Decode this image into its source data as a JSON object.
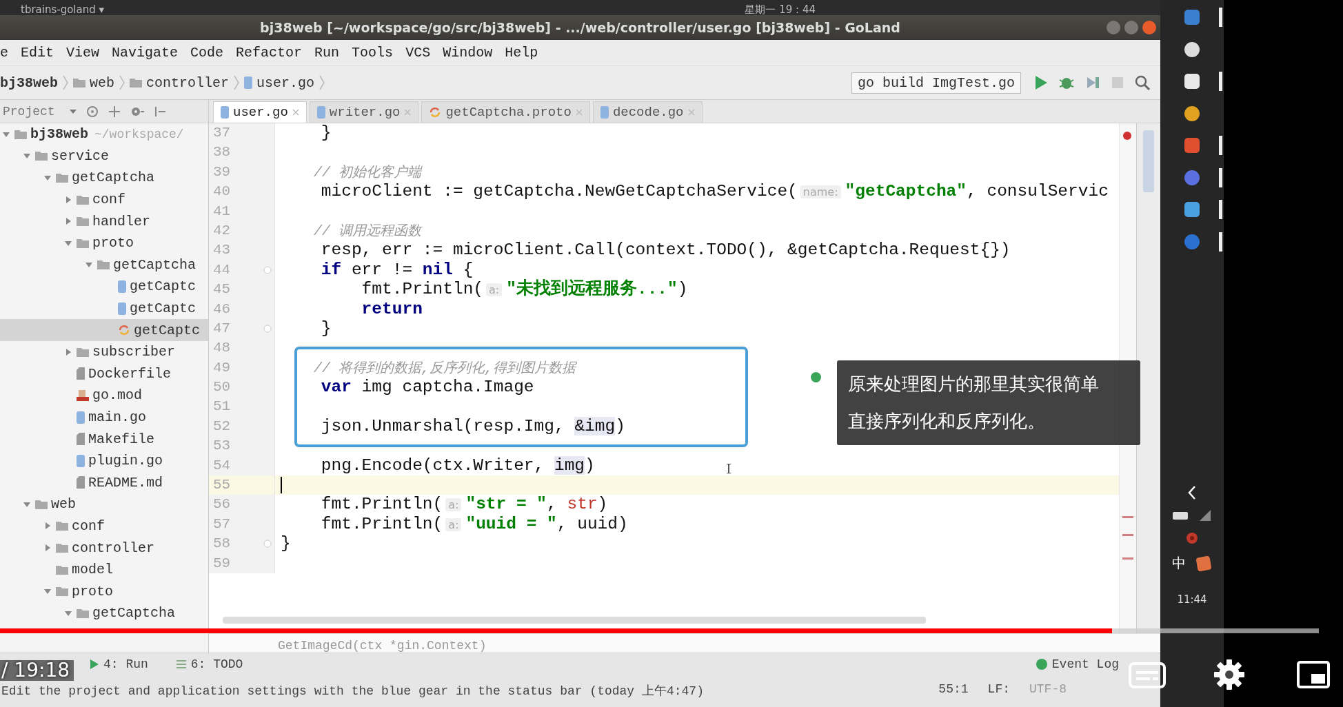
{
  "system_bar": {
    "app_menu": "tbrains-goland ▾",
    "clock": "星期一 19 : 44"
  },
  "window": {
    "title": "bj38web [~/workspace/go/src/bj38web] - .../web/controller/user.go [bj38web] - GoLand"
  },
  "menu": [
    "e",
    "Edit",
    "View",
    "Navigate",
    "Code",
    "Refactor",
    "Run",
    "Tools",
    "VCS",
    "Window",
    "Help"
  ],
  "navigation": {
    "breadcrumb": [
      {
        "label": "bj38web",
        "kind": "project"
      },
      {
        "label": "web",
        "kind": "folder"
      },
      {
        "label": "controller",
        "kind": "folder"
      },
      {
        "label": "user.go",
        "kind": "go"
      }
    ],
    "run_config": "go build ImgTest.go"
  },
  "project_panel": {
    "title": "Project",
    "tree": [
      {
        "label": "bj38web",
        "path": "~/workspace/",
        "kind": "folder",
        "expanded": true,
        "selected": false,
        "children": [
          {
            "label": "service",
            "kind": "folder",
            "expanded": true,
            "selected": false,
            "children": [
              {
                "label": "getCaptcha",
                "kind": "folder",
                "expanded": true,
                "selected": false,
                "children": [
                  {
                    "label": "conf",
                    "kind": "folder",
                    "expanded": false,
                    "selected": false
                  },
                  {
                    "label": "handler",
                    "kind": "folder",
                    "expanded": false,
                    "selected": false
                  },
                  {
                    "label": "proto",
                    "kind": "folder",
                    "expanded": true,
                    "selected": false,
                    "children": [
                      {
                        "label": "getCaptcha",
                        "kind": "folder",
                        "expanded": true,
                        "selected": false,
                        "children": [
                          {
                            "label": "getCaptc",
                            "kind": "go",
                            "selected": false
                          },
                          {
                            "label": "getCaptc",
                            "kind": "go",
                            "selected": false
                          },
                          {
                            "label": "getCaptc",
                            "kind": "proto",
                            "selected": true
                          }
                        ]
                      }
                    ]
                  },
                  {
                    "label": "subscriber",
                    "kind": "folder",
                    "expanded": false,
                    "selected": false
                  },
                  {
                    "label": "Dockerfile",
                    "kind": "file",
                    "selected": false
                  },
                  {
                    "label": "go.mod",
                    "kind": "mod",
                    "selected": false
                  },
                  {
                    "label": "main.go",
                    "kind": "go",
                    "selected": false
                  },
                  {
                    "label": "Makefile",
                    "kind": "file",
                    "selected": false
                  },
                  {
                    "label": "plugin.go",
                    "kind": "go",
                    "selected": false
                  },
                  {
                    "label": "README.md",
                    "kind": "file",
                    "selected": false
                  }
                ]
              }
            ]
          },
          {
            "label": "web",
            "kind": "folder",
            "expanded": true,
            "selected": false,
            "children": [
              {
                "label": "conf",
                "kind": "folder",
                "expanded": false,
                "selected": false
              },
              {
                "label": "controller",
                "kind": "folder",
                "expanded": false,
                "selected": false
              },
              {
                "label": "model",
                "kind": "folder",
                "selected": false
              },
              {
                "label": "proto",
                "kind": "folder",
                "expanded": true,
                "selected": false,
                "children": [
                  {
                    "label": "getCaptcha",
                    "kind": "folder",
                    "expanded": true,
                    "selected": false
                  }
                ]
              }
            ]
          }
        ]
      }
    ]
  },
  "tabs": [
    {
      "label": "user.go",
      "kind": "go",
      "selected": true
    },
    {
      "label": "writer.go",
      "kind": "go",
      "selected": false
    },
    {
      "label": "getCaptcha.proto",
      "kind": "proto",
      "selected": false
    },
    {
      "label": "decode.go",
      "kind": "go",
      "selected": false
    }
  ],
  "editor": {
    "lines": [
      {
        "number": "37",
        "fold": false,
        "current": false,
        "segments": [
          {
            "kind": "plain",
            "text": "    }"
          }
        ]
      },
      {
        "number": "38",
        "fold": false,
        "current": false
      },
      {
        "number": "39",
        "fold": false,
        "current": false,
        "segments": [
          {
            "kind": "comment",
            "text": "    // 初始化客户端"
          }
        ]
      },
      {
        "number": "40",
        "fold": false,
        "current": false,
        "segments": [
          {
            "kind": "plain",
            "text": "    microClient := getCaptcha.NewGetCaptchaService("
          },
          {
            "kind": "hint",
            "text": "name:"
          },
          {
            "kind": "string",
            "text": "\"getCaptcha\""
          },
          {
            "kind": "plain",
            "text": ", consulServic"
          }
        ]
      },
      {
        "number": "41",
        "fold": false,
        "current": false
      },
      {
        "number": "42",
        "fold": false,
        "current": false,
        "segments": [
          {
            "kind": "comment",
            "text": "    // 调用远程函数"
          }
        ]
      },
      {
        "number": "43",
        "fold": false,
        "current": false,
        "segments": [
          {
            "kind": "plain",
            "text": "    resp, err := microClient.Call(context.TODO(), &getCaptcha.Request{})"
          }
        ]
      },
      {
        "number": "44",
        "fold": true,
        "current": false,
        "segments": [
          {
            "kind": "keyword",
            "text": "    if"
          },
          {
            "kind": "plain",
            "text": " err != "
          },
          {
            "kind": "keyword",
            "text": "nil"
          },
          {
            "kind": "plain",
            "text": " {"
          }
        ]
      },
      {
        "number": "45",
        "fold": false,
        "current": false,
        "segments": [
          {
            "kind": "plain",
            "text": "        fmt.Println("
          },
          {
            "kind": "hint",
            "text": "a:"
          },
          {
            "kind": "string",
            "text": "\"未找到远程服务...\""
          },
          {
            "kind": "plain",
            "text": ")"
          }
        ]
      },
      {
        "number": "46",
        "fold": false,
        "current": false,
        "segments": [
          {
            "kind": "keyword",
            "text": "        return"
          }
        ]
      },
      {
        "number": "47",
        "fold": true,
        "current": false,
        "segments": [
          {
            "kind": "plain",
            "text": "    }"
          }
        ]
      },
      {
        "number": "48",
        "fold": false,
        "current": false
      },
      {
        "number": "49",
        "fold": false,
        "current": false,
        "segments": [
          {
            "kind": "comment",
            "text": "    // 将得到的数据,反序列化,得到图片数据"
          }
        ]
      },
      {
        "number": "50",
        "fold": false,
        "current": false,
        "segments": [
          {
            "kind": "keyword",
            "text": "    var"
          },
          {
            "kind": "plain",
            "text": " img captcha.Image"
          }
        ]
      },
      {
        "number": "51",
        "fold": false,
        "current": false
      },
      {
        "number": "52",
        "fold": false,
        "current": false,
        "segments": [
          {
            "kind": "plain",
            "text": "    json.Unmarshal(resp.Img, "
          },
          {
            "kind": "usage",
            "text": "&img"
          },
          {
            "kind": "plain",
            "text": ")"
          }
        ]
      },
      {
        "number": "53",
        "fold": false,
        "current": false
      },
      {
        "number": "54",
        "fold": false,
        "current": false,
        "segments": [
          {
            "kind": "plain",
            "text": "    png.Encode(ctx.Writer, "
          },
          {
            "kind": "usage",
            "text": "img"
          },
          {
            "kind": "plain",
            "text": ")"
          }
        ]
      },
      {
        "number": "55",
        "fold": false,
        "current": true
      },
      {
        "number": "56",
        "fold": false,
        "current": false,
        "segments": [
          {
            "kind": "plain",
            "text": "    fmt.Println("
          },
          {
            "kind": "hint",
            "text": "a:"
          },
          {
            "kind": "string",
            "text": "\"str = \""
          },
          {
            "kind": "plain",
            "text": ", "
          },
          {
            "kind": "field",
            "text": "str"
          },
          {
            "kind": "plain",
            "text": ")"
          }
        ]
      },
      {
        "number": "57",
        "fold": false,
        "current": false,
        "segments": [
          {
            "kind": "plain",
            "text": "    fmt.Println("
          },
          {
            "kind": "hint",
            "text": "a:"
          },
          {
            "kind": "string",
            "text": "\"uuid = \""
          },
          {
            "kind": "plain",
            "text": ", uuid)"
          }
        ]
      },
      {
        "number": "58",
        "fold": true,
        "current": false,
        "segments": [
          {
            "kind": "plain",
            "text": "}"
          }
        ]
      },
      {
        "number": "59",
        "fold": false,
        "current": false
      }
    ],
    "breadcrumb": "GetImageCd(ctx *gin.Context)"
  },
  "annotation": {
    "caption": [
      "原来处理图片的那里其实很简单",
      "直接序列化和反序列化。"
    ]
  },
  "tool_windows": [
    {
      "label": "4: Run",
      "kind": "run"
    },
    {
      "label": "6: TODO",
      "kind": "todo"
    },
    {
      "label": "Event Log",
      "kind": "log"
    }
  ],
  "status_bar": {
    "message": "Edit the project and application settings with the blue gear in the status bar (today 上午4:47)",
    "position": "55:1",
    "line_separator": "LF:",
    "encoding": "UTF-8"
  },
  "taskbar": {
    "input_method": "中",
    "clock": "11:44"
  },
  "player": {
    "time": "/ 19:18",
    "progress": {
      "level": 0.843
    }
  }
}
